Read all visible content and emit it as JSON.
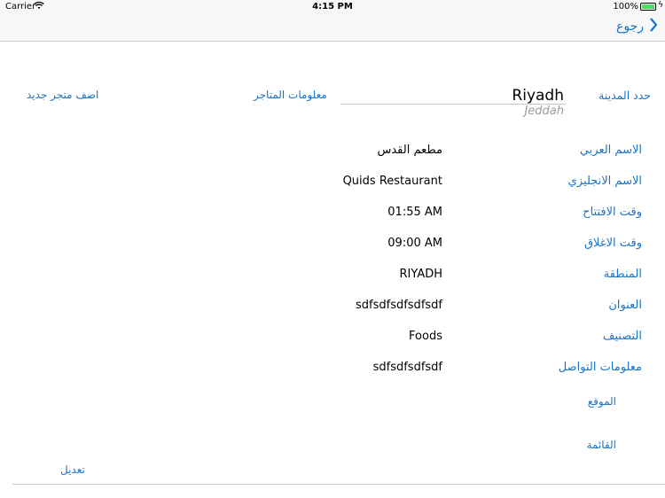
{
  "status_bar": {
    "carrier": "Carrier",
    "time": "4:15 PM",
    "battery": "100%"
  },
  "nav": {
    "back_label": "رجوع"
  },
  "toolbar": {
    "add_store": "اضف متجر جديد",
    "store_info": "معلومات المتاجر",
    "select_city": "حدد المدينة"
  },
  "city_picker": {
    "selected": "Riyadh",
    "next": "Jeddah"
  },
  "fields": [
    {
      "label": "الاسم العربي",
      "value": "مطعم القدس"
    },
    {
      "label": "الاسم الانجليزي",
      "value": "Quids Restaurant"
    },
    {
      "label": "وقت الافتتاح",
      "value": "01:55 AM"
    },
    {
      "label": "وقت الاغلاق",
      "value": "09:00 AM"
    },
    {
      "label": "المنطقة",
      "value": "RIYADH"
    },
    {
      "label": "العنوان",
      "value": "sdfsdfsdfsdfsdf"
    },
    {
      "label": "التصنيف",
      "value": "Foods"
    },
    {
      "label": "معلومات التواصل",
      "value": "sdfsdfsdfsdf"
    }
  ],
  "links": {
    "location": "الموقع",
    "menu": "القائمة",
    "edit": "تعديل"
  },
  "colors": {
    "accent": "#1a73c7",
    "battery": "#4cd964"
  }
}
